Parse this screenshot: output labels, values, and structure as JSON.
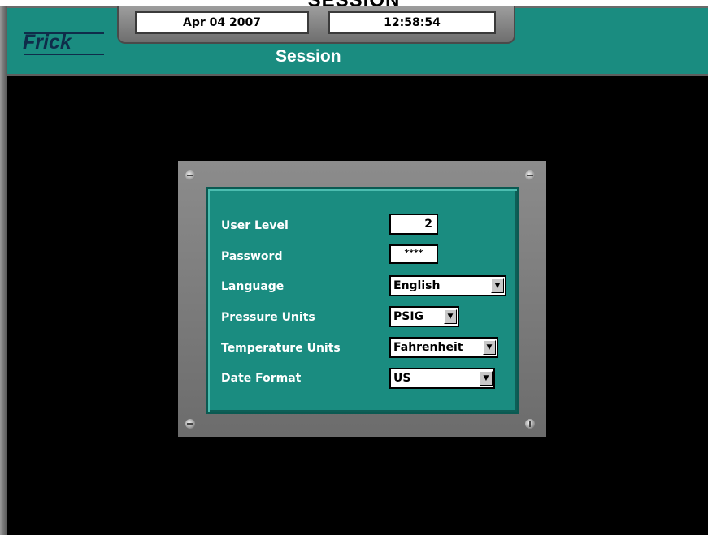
{
  "window": {
    "caption": "SESSION",
    "logo_text": "Frick",
    "date": "Apr 04 2007",
    "time": "12:58:54",
    "page_title": "Session"
  },
  "form": {
    "user_level": {
      "label": "User Level",
      "value": "2"
    },
    "password": {
      "label": "Password",
      "value": "****"
    },
    "language": {
      "label": "Language",
      "value": "English"
    },
    "pressure_units": {
      "label": "Pressure Units",
      "value": "PSIG"
    },
    "temperature_units": {
      "label": "Temperature Units",
      "value": "Fahrenheit"
    },
    "date_format": {
      "label": "Date Format",
      "value": "US"
    }
  },
  "icons": {
    "dropdown": "chevron-down-icon",
    "screw": "screw-icon"
  },
  "colors": {
    "header_teal": "#1a8c80",
    "panel_teal": "#1a8c80",
    "background": "#000000",
    "logo_navy": "#0f2c4a"
  }
}
